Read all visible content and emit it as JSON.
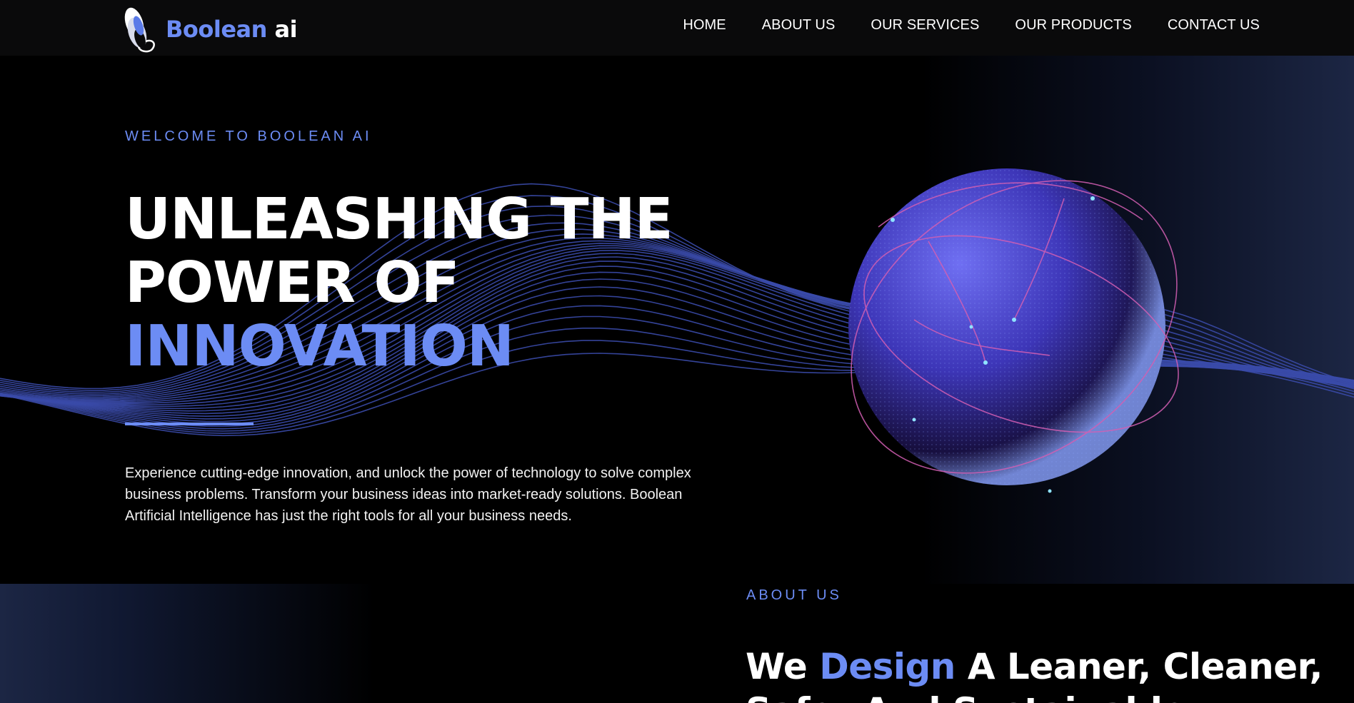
{
  "brand": {
    "name_part1": "Boolean",
    "name_part2": "ai",
    "accent_color": "#6c8cf4"
  },
  "nav": {
    "items": [
      {
        "label": "HOME"
      },
      {
        "label": "ABOUT US"
      },
      {
        "label": "OUR SERVICES"
      },
      {
        "label": "OUR PRODUCTS"
      },
      {
        "label": "CONTACT US"
      }
    ]
  },
  "hero": {
    "eyebrow": "WELCOME TO BOOLEAN AI",
    "headline_line1": "UNLEASHING THE",
    "headline_line2": "POWER OF",
    "headline_line3": "INNOVATION",
    "description": "Experience cutting-edge innovation, and unlock the power of technology to solve complex business problems. Transform your business ideas into market-ready solutions. Boolean Artificial Intelligence has just the right tools for all your business needs.",
    "wave_color": "#3a4aa8",
    "globe_color": "#5b5fe0"
  },
  "about": {
    "eyebrow": "ABOUT US",
    "title_part1": "We",
    "title_accent": "Design",
    "title_part2": "A Leaner, Cleaner,",
    "title_line2": "Safer And Sustainable"
  }
}
